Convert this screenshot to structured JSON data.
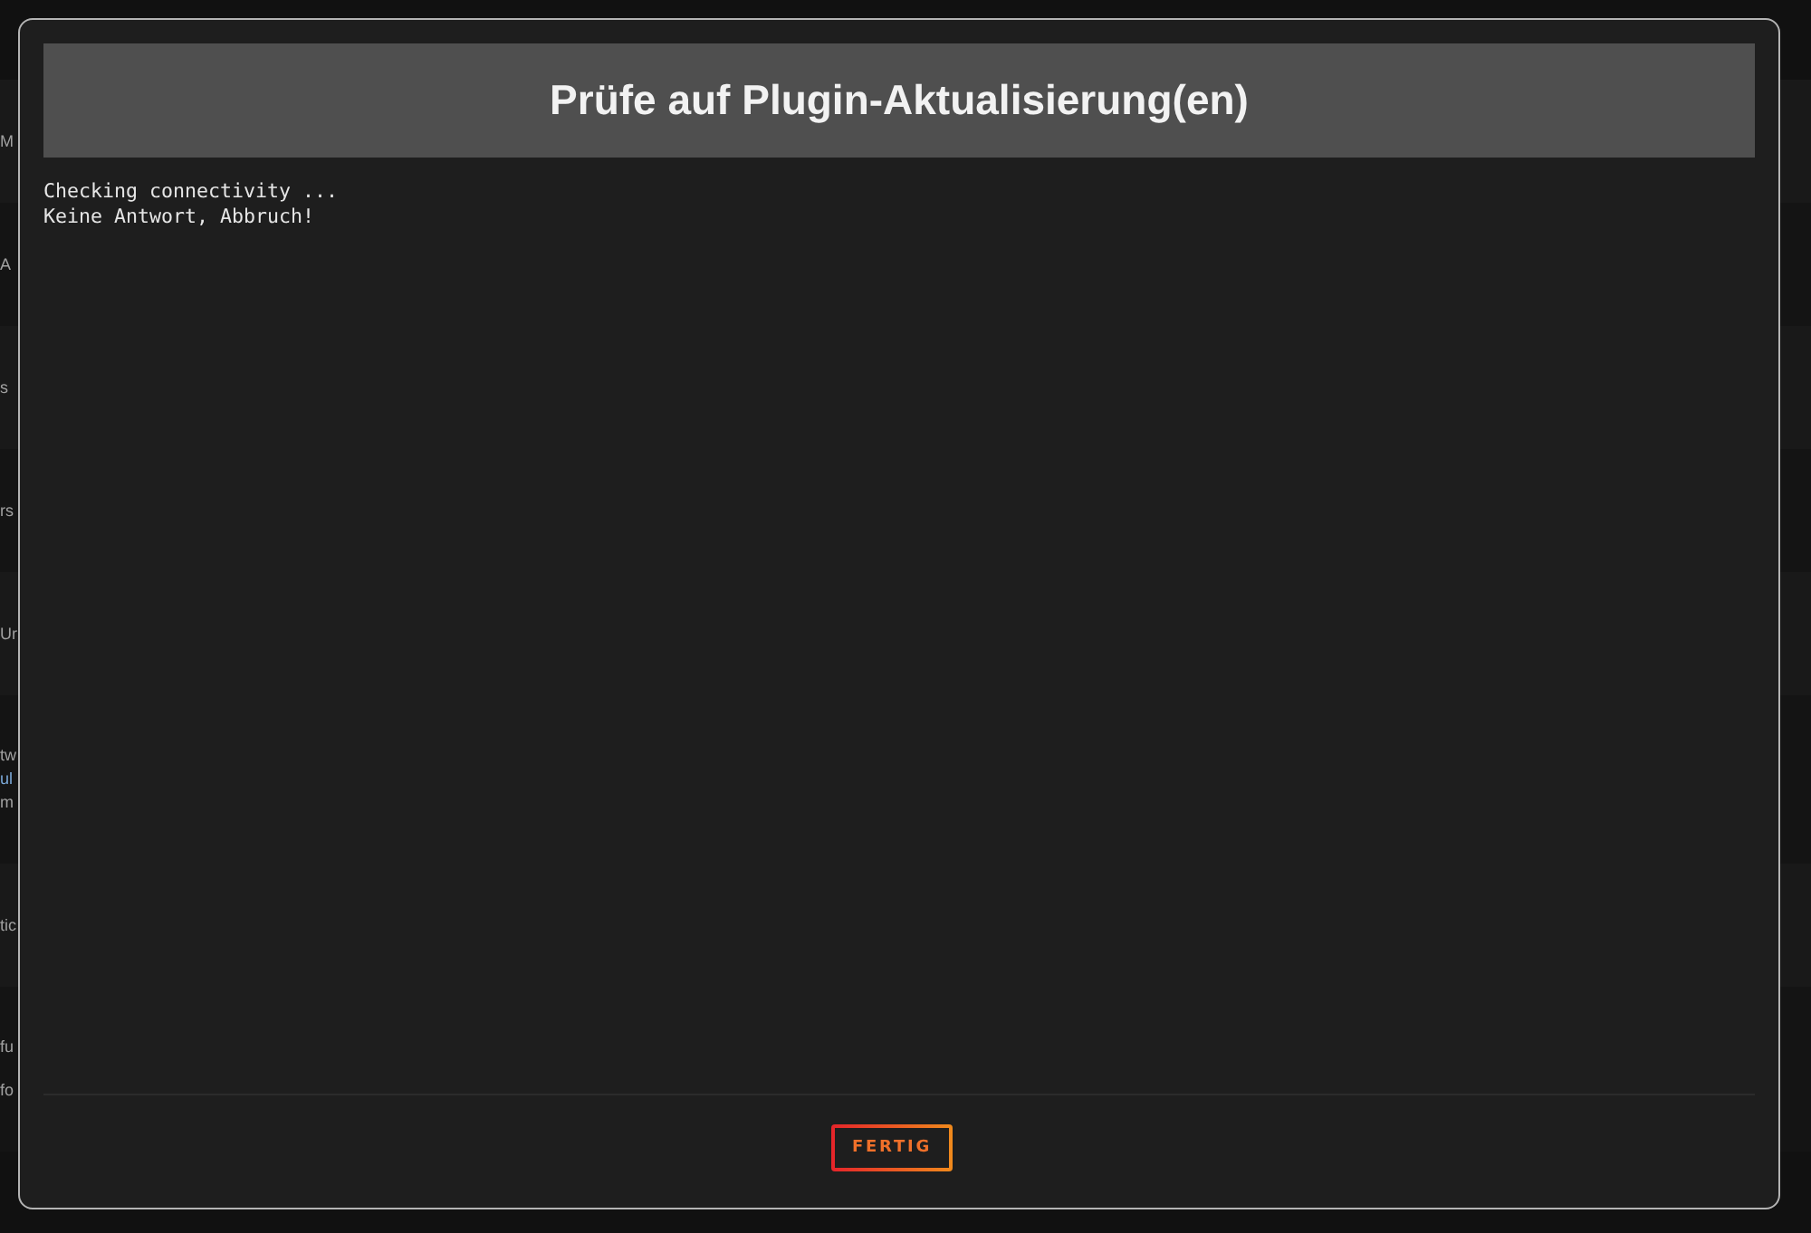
{
  "background_rows": [
    {
      "lines": [
        {
          "text": "M",
          "kind": "text"
        }
      ]
    },
    {
      "lines": [
        {
          "text": "A",
          "kind": "text"
        }
      ]
    },
    {
      "lines": [
        {
          "text": "s",
          "kind": "text"
        }
      ]
    },
    {
      "lines": [
        {
          "text": "rs",
          "kind": "text"
        }
      ]
    },
    {
      "lines": [
        {
          "text": "Ur",
          "kind": "text"
        }
      ]
    },
    {
      "lines": [
        {
          "text": "tw",
          "kind": "text"
        },
        {
          "text": "ul",
          "kind": "link"
        },
        {
          "text": "m",
          "kind": "text"
        }
      ]
    },
    {
      "lines": [
        {
          "text": "tic",
          "kind": "text"
        }
      ]
    },
    {
      "lines": [
        {
          "text": "fu",
          "kind": "text"
        },
        {
          "text": "fo",
          "kind": "text"
        }
      ]
    }
  ],
  "dialog": {
    "title": "Prüfe auf Plugin-Aktualisierung(en)",
    "log_lines": [
      "Checking connectivity ...",
      "Keine Antwort, Abbruch!"
    ],
    "button": "FERTIG"
  }
}
